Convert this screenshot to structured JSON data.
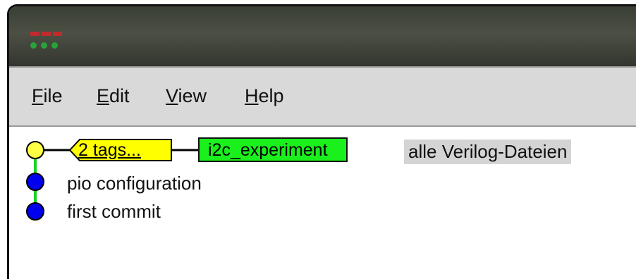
{
  "window": {
    "title_bar_controls": [
      "close",
      "minimize",
      "maximize"
    ]
  },
  "menu": {
    "items": [
      {
        "label": "File",
        "mnemonic": "F",
        "rest": "ile"
      },
      {
        "label": "Edit",
        "mnemonic": "E",
        "rest": "dit"
      },
      {
        "label": "View",
        "mnemonic": "V",
        "rest": "iew"
      },
      {
        "label": "Help",
        "mnemonic": "H",
        "rest": "elp"
      }
    ]
  },
  "commits": [
    {
      "message": "alle Verilog-Dateien",
      "tag_label": "2 tags...",
      "branch": "i2c_experiment",
      "dot_color": "#ffff44",
      "is_head": true
    },
    {
      "message": "pio configuration",
      "dot_color": "#0000ee",
      "is_head": false
    },
    {
      "message": "first commit",
      "dot_color": "#0000ee",
      "is_head": false
    }
  ],
  "colors": {
    "graph_line": "#19d21c",
    "tag_fill": "#ffff00",
    "branch_fill": "#19f01c",
    "head_highlight": "#d4d4d4"
  }
}
